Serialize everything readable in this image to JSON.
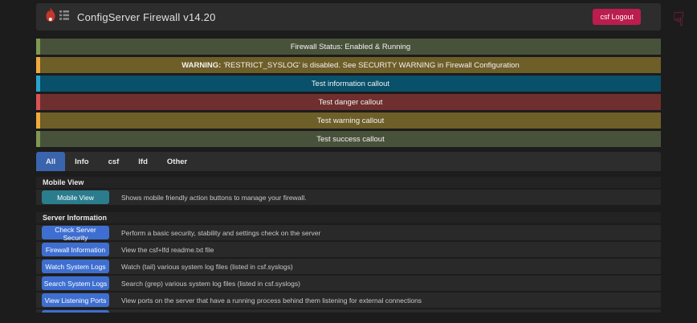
{
  "header": {
    "title": "ConfigServer Firewall v14.20",
    "logout_label": "csf Logout"
  },
  "icons": {
    "logo": "flame-icon with list glyph",
    "hand_glyph": "☟"
  },
  "callouts": [
    {
      "type": "success",
      "text": "Firewall Status: Enabled & Running"
    },
    {
      "type": "warning",
      "prefix": "WARNING:",
      "text": " 'RESTRICT_SYSLOG' is disabled. See SECURITY WARNING in Firewall Configuration"
    },
    {
      "type": "info",
      "text": "Test information callout"
    },
    {
      "type": "danger",
      "text": "Test danger callout"
    },
    {
      "type": "warning",
      "text": "Test warning callout"
    },
    {
      "type": "success",
      "text": "Test success callout"
    }
  ],
  "tabs": [
    {
      "label": "All",
      "active": true
    },
    {
      "label": "Info",
      "active": false
    },
    {
      "label": "csf",
      "active": false
    },
    {
      "label": "lfd",
      "active": false
    },
    {
      "label": "Other",
      "active": false
    }
  ],
  "sections": [
    {
      "title": "Mobile View",
      "rows": [
        {
          "button": "Mobile View",
          "description": "Shows mobile friendly action buttons to manage your firewall."
        }
      ]
    },
    {
      "title": "Server Information",
      "rows": [
        {
          "button": "Check Server Security",
          "description": "Perform a basic security, stability and settings check on the server"
        },
        {
          "button": "Firewall Information",
          "description": "View the csf+lfd readme.txt file"
        },
        {
          "button": "Watch System Logs",
          "description": "Watch (tail) various system log files (listed in csf.syslogs)"
        },
        {
          "button": "Search System Logs",
          "description": "Search (grep) various system log files (listed in csf.syslogs)"
        },
        {
          "button": "View Listening Ports",
          "description": "View ports on the server that have a running process behind them listening for external connections"
        }
      ]
    }
  ],
  "colors": {
    "page_bg": "#1c1c1c",
    "header_bg": "#2d2d2d",
    "accent_crimson": "#ba1d4e",
    "button_blue": "#3e6fd0",
    "button_teal": "#2b7d8e",
    "tab_active_blue": "#3a64ae",
    "success_bg": "#48523a",
    "success_border": "#7e9850",
    "warning_bg": "#6e5e28",
    "warning_border": "#f2a93c",
    "info_bg": "#09506a",
    "info_border": "#29a4cd",
    "danger_bg": "#702f2f",
    "danger_border": "#d75353"
  }
}
